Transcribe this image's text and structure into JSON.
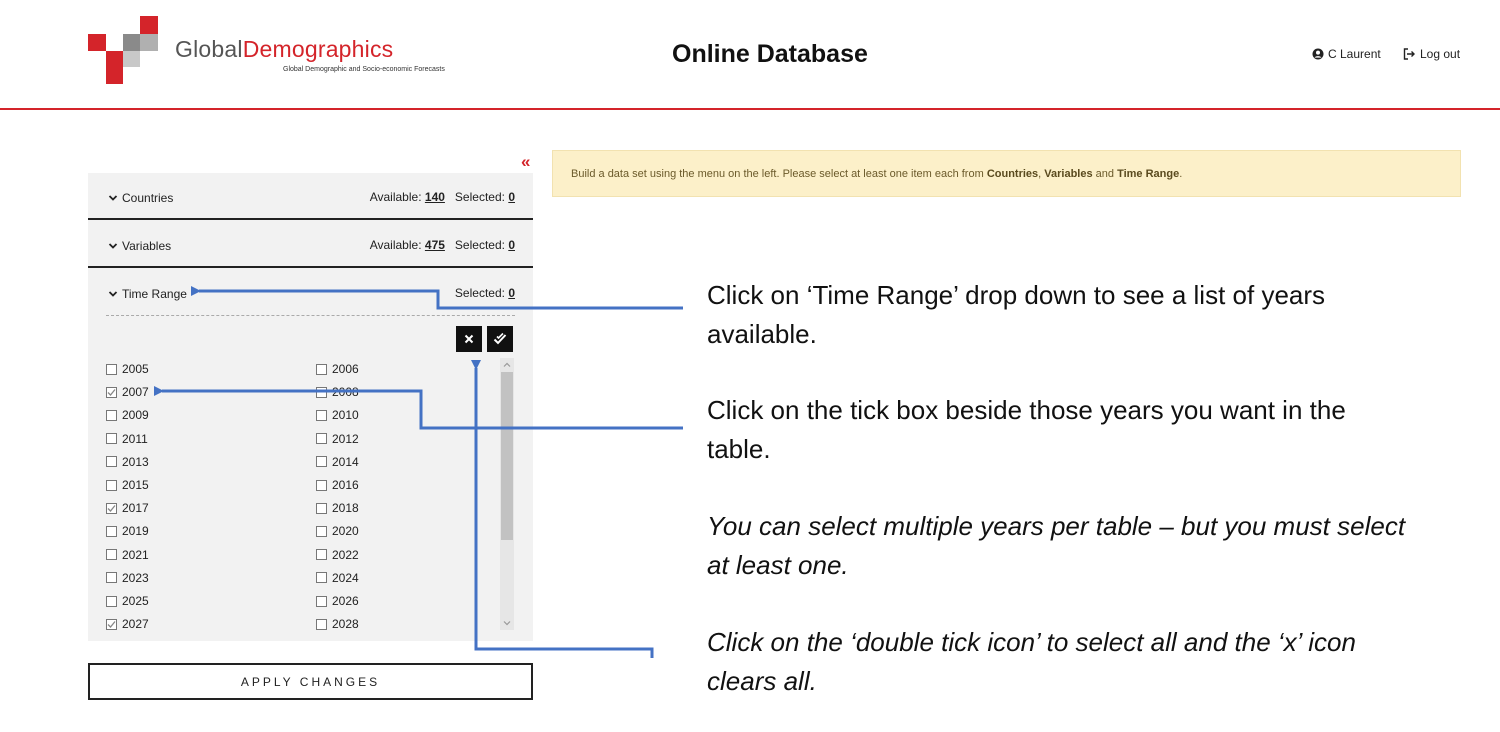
{
  "header": {
    "brand_part1": "Global",
    "brand_part2": "Demographics",
    "tagline": "Global Demographic and Socio-economic Forecasts",
    "page_title": "Online Database",
    "user_name": "C Laurent",
    "logout_label": "Log out"
  },
  "sidebar": {
    "collapse_glyph": "«",
    "sections": {
      "countries": {
        "label": "Countries",
        "available_label": "Available:",
        "available": "140",
        "selected_label": "Selected:",
        "selected": "0"
      },
      "variables": {
        "label": "Variables",
        "available_label": "Available:",
        "available": "475",
        "selected_label": "Selected:",
        "selected": "0"
      },
      "time_range": {
        "label": "Time Range",
        "selected_label": "Selected:",
        "selected": "0"
      }
    },
    "years": [
      {
        "year": "2005",
        "checked": false
      },
      {
        "year": "2006",
        "checked": false
      },
      {
        "year": "2007",
        "checked": true
      },
      {
        "year": "2008",
        "checked": false
      },
      {
        "year": "2009",
        "checked": false
      },
      {
        "year": "2010",
        "checked": false
      },
      {
        "year": "2011",
        "checked": false
      },
      {
        "year": "2012",
        "checked": false
      },
      {
        "year": "2013",
        "checked": false
      },
      {
        "year": "2014",
        "checked": false
      },
      {
        "year": "2015",
        "checked": false
      },
      {
        "year": "2016",
        "checked": false
      },
      {
        "year": "2017",
        "checked": true
      },
      {
        "year": "2018",
        "checked": false
      },
      {
        "year": "2019",
        "checked": false
      },
      {
        "year": "2020",
        "checked": false
      },
      {
        "year": "2021",
        "checked": false
      },
      {
        "year": "2022",
        "checked": false
      },
      {
        "year": "2023",
        "checked": false
      },
      {
        "year": "2024",
        "checked": false
      },
      {
        "year": "2025",
        "checked": false
      },
      {
        "year": "2026",
        "checked": false
      },
      {
        "year": "2027",
        "checked": true
      },
      {
        "year": "2028",
        "checked": false
      }
    ],
    "apply_label": "APPLY CHANGES"
  },
  "alert": {
    "text_prefix": "Build a data set using the menu on the left. Please select at least one item each from ",
    "item1": "Countries",
    "sep1": ", ",
    "item2": "Variables",
    "sep2": " and ",
    "item3": "Time Range",
    "suffix": "."
  },
  "annotations": {
    "note1": "Click on ‘Time Range’ drop down to see a list of years available.",
    "note2": "Click on the tick box beside those years you want in the table.",
    "note3": "You can select multiple years per table – but you must select at least one.",
    "note4": "Click on the ‘double tick icon’ to select all and the ‘x’ icon clears all."
  },
  "colors": {
    "brand_red": "#d4242a",
    "callout_blue": "#4472c4",
    "alert_bg": "#fcf0c9"
  }
}
